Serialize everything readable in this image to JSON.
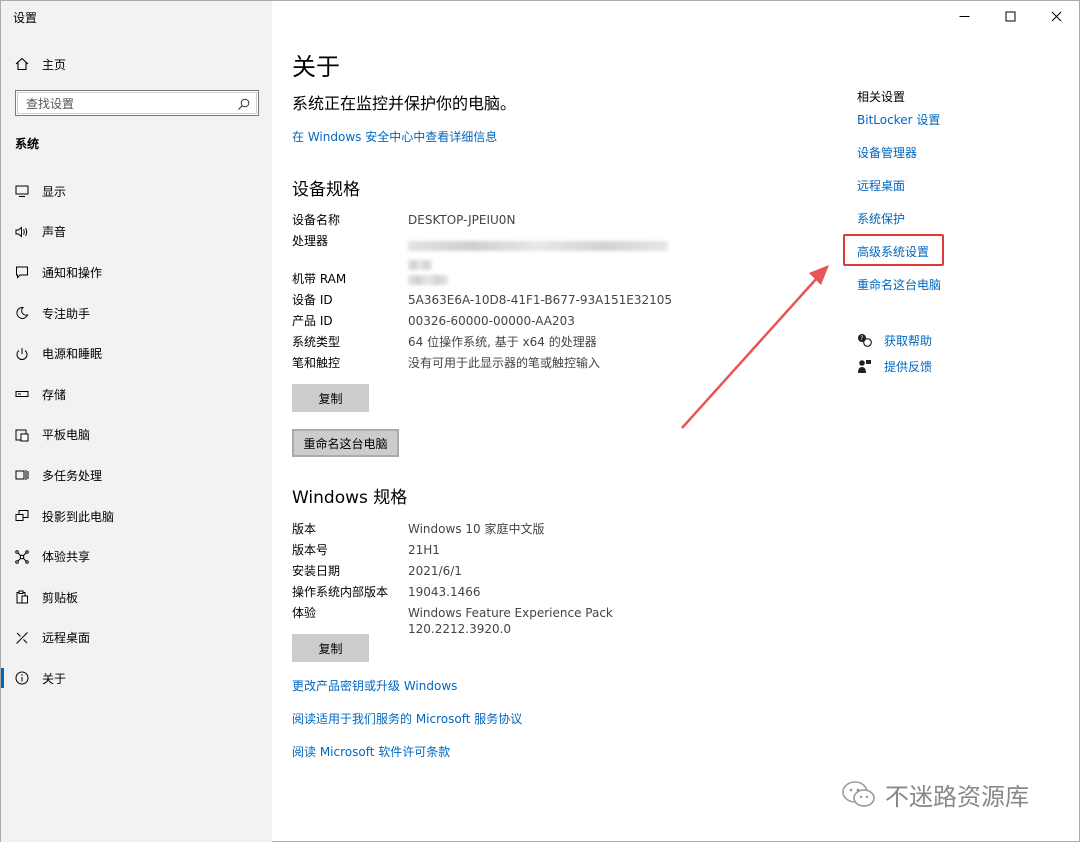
{
  "app": {
    "title": "设置"
  },
  "sidebar": {
    "home_label": "主页",
    "search_placeholder": "查找设置",
    "section": "系统",
    "items": [
      {
        "label": "显示",
        "icon": "monitor-icon"
      },
      {
        "label": "声音",
        "icon": "speaker-icon"
      },
      {
        "label": "通知和操作",
        "icon": "notification-icon"
      },
      {
        "label": "专注助手",
        "icon": "moon-icon"
      },
      {
        "label": "电源和睡眠",
        "icon": "power-icon"
      },
      {
        "label": "存储",
        "icon": "storage-icon"
      },
      {
        "label": "平板电脑",
        "icon": "tablet-icon"
      },
      {
        "label": "多任务处理",
        "icon": "multitask-icon"
      },
      {
        "label": "投影到此电脑",
        "icon": "project-icon"
      },
      {
        "label": "体验共享",
        "icon": "share-icon"
      },
      {
        "label": "剪贴板",
        "icon": "clipboard-icon"
      },
      {
        "label": "远程桌面",
        "icon": "remote-icon"
      },
      {
        "label": "关于",
        "icon": "info-icon",
        "active": true
      }
    ]
  },
  "main": {
    "title": "关于",
    "subtitle": "系统正在监控并保护你的电脑。",
    "security_link": "在 Windows 安全中心中查看详细信息",
    "device_heading": "设备规格",
    "device_specs": [
      {
        "key": "设备名称",
        "value": "DESKTOP-JPEIU0N"
      },
      {
        "key": "处理器",
        "value": ""
      },
      {
        "key": "机带 RAM",
        "value": ""
      },
      {
        "key": "设备 ID",
        "value": "5A363E6A-10D8-41F1-B677-93A151E32105"
      },
      {
        "key": "产品 ID",
        "value": "00326-60000-00000-AA203"
      },
      {
        "key": "系统类型",
        "value": "64 位操作系统, 基于 x64 的处理器"
      },
      {
        "key": "笔和触控",
        "value": "没有可用于此显示器的笔或触控输入"
      }
    ],
    "copy_label": "复制",
    "rename_label": "重命名这台电脑",
    "windows_heading": "Windows 规格",
    "windows_specs": [
      {
        "key": "版本",
        "value": "Windows 10 家庭中文版"
      },
      {
        "key": "版本号",
        "value": "21H1"
      },
      {
        "key": "安装日期",
        "value": "2021/6/1"
      },
      {
        "key": "操作系统内部版本",
        "value": "19043.1466"
      },
      {
        "key": "体验",
        "value": "Windows Feature Experience Pack 120.2212.3920.0"
      }
    ],
    "copy2_label": "复制",
    "links": [
      "更改产品密钥或升级 Windows",
      "阅读适用于我们服务的 Microsoft 服务协议",
      "阅读 Microsoft 软件许可条款"
    ]
  },
  "related": {
    "title": "相关设置",
    "links": [
      "BitLocker 设置",
      "设备管理器",
      "远程桌面",
      "系统保护",
      "高级系统设置",
      "重命名这台电脑"
    ],
    "help_label": "获取帮助",
    "feedback_label": "提供反馈"
  },
  "watermark": {
    "text": "不迷路资源库"
  },
  "colors": {
    "accent": "#0067c0",
    "highlight": "#e03a3a"
  }
}
